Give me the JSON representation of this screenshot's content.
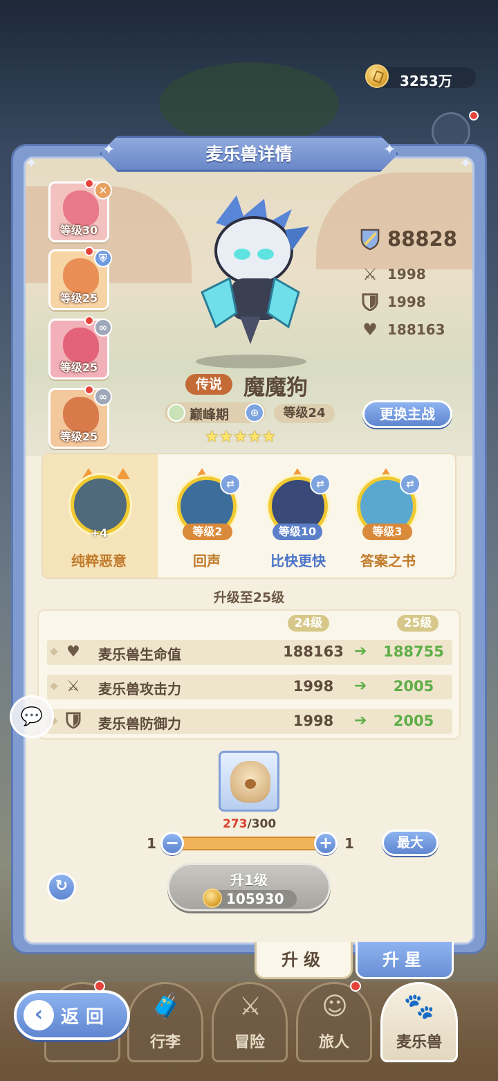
{
  "currency": {
    "amount": "3253万"
  },
  "panel": {
    "title": "麦乐兽详情"
  },
  "pets": [
    {
      "level": "等级30",
      "color": "#e7798a",
      "badge": "✕",
      "badge_color": "#e8a060"
    },
    {
      "level": "等级25",
      "color": "#e98f55",
      "badge": "⛨",
      "badge_color": "#6f9be0"
    },
    {
      "level": "等级25",
      "color": "#e3647a",
      "badge": "∞",
      "badge_color": "#9fa8b8"
    },
    {
      "level": "等级25",
      "color": "#d97a4a",
      "badge": "∞",
      "badge_color": "#9fa8b8"
    }
  ],
  "stats": {
    "power": "88828",
    "attack": "1998",
    "defense": "1998",
    "hp": "188163"
  },
  "pet": {
    "rarity": "传说",
    "name": "魔魔狗",
    "stage": "巅峰期",
    "level": "等级24",
    "stars": "★★★★★",
    "switch_label": "更换主战"
  },
  "skills": [
    {
      "name": "纯粹恶意",
      "level": "+4",
      "name_color": "#c07a2a",
      "circle": "#4f6a7a"
    },
    {
      "name": "回声",
      "level": "等级2",
      "name_color": "#c07a2a",
      "level_bg": "#d98a3a",
      "circle": "#3d6d9a"
    },
    {
      "name": "比快更快",
      "level": "等级10",
      "name_color": "#4a74c8",
      "level_bg": "#5b7fc8",
      "circle": "#3a4a78"
    },
    {
      "name": "答案之书",
      "level": "等级3",
      "name_color": "#c07a2a",
      "level_bg": "#d98a3a",
      "circle": "#5aa8d0"
    }
  ],
  "upgrade": {
    "title": "升级至25级",
    "from_level": "24级",
    "to_level": "25级",
    "rows": [
      {
        "label": "麦乐兽生命值",
        "icon": "heart-icon",
        "from": "188163",
        "to": "188755"
      },
      {
        "label": "麦乐兽攻击力",
        "icon": "swords-icon",
        "from": "1998",
        "to": "2005"
      },
      {
        "label": "麦乐兽防御力",
        "icon": "shield-icon",
        "from": "1998",
        "to": "2005"
      }
    ]
  },
  "item": {
    "owned": "273",
    "required": "/300"
  },
  "slider": {
    "min": "1",
    "max": "1",
    "max_button": "最大"
  },
  "levelup": {
    "label": "升1级",
    "cost": "105930"
  },
  "sub_tabs": {
    "upgrade": "升级",
    "star": "升星"
  },
  "nav": {
    "back": "返回",
    "items": [
      "行李",
      "冒险",
      "旅人",
      "麦乐兽"
    ]
  }
}
